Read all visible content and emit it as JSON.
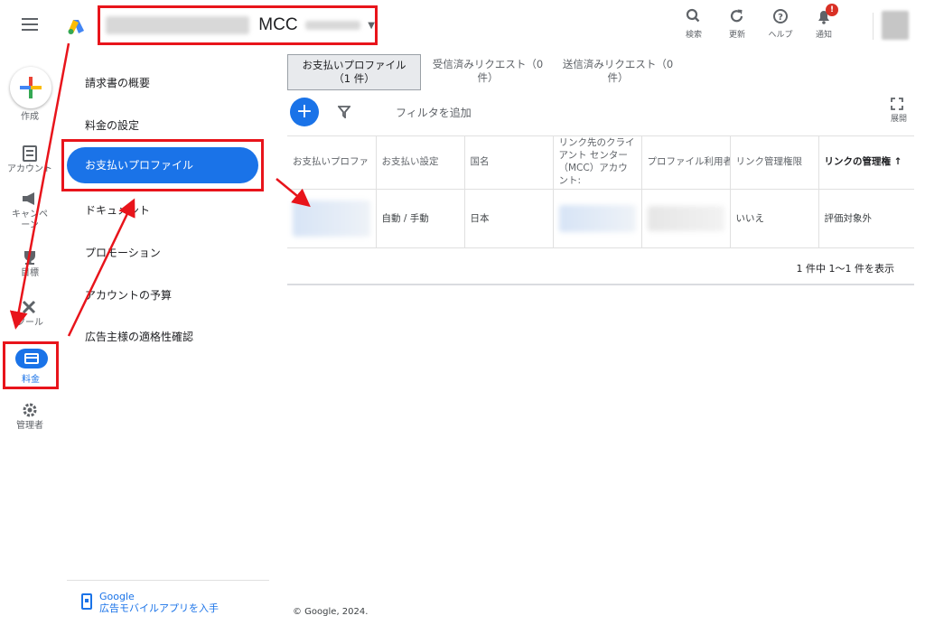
{
  "header": {
    "account_name": "MCC",
    "actions": [
      {
        "label": "検索",
        "icon": "search-icon"
      },
      {
        "label": "更新",
        "icon": "refresh-icon"
      },
      {
        "label": "ヘルプ",
        "icon": "help-icon"
      },
      {
        "label": "通知",
        "icon": "bell-icon",
        "badge": "!"
      }
    ]
  },
  "rail": {
    "create_label": "作成",
    "items": [
      {
        "label": "アカウント",
        "icon": "account-icon"
      },
      {
        "label": "キャンペーン",
        "icon": "megaphone-icon"
      },
      {
        "label": "目標",
        "icon": "trophy-icon"
      },
      {
        "label": "ツール",
        "icon": "tools-icon"
      },
      {
        "label": "料金",
        "icon": "billing-card-icon",
        "active": true
      },
      {
        "label": "管理者",
        "icon": "gear-icon"
      }
    ]
  },
  "subnav": {
    "items": [
      "請求書の概要",
      "料金の設定",
      "お支払いプロファイル",
      "ドキュメント",
      "プロモーション",
      "アカウントの予算",
      "広告主様の適格性確認"
    ],
    "active": "お支払いプロファイル",
    "app_promo_line1": "Google",
    "app_promo_line2": "広告モバイルアプリを入手"
  },
  "tabs": [
    {
      "label": "お支払いプロファイル",
      "count": "（1 件）",
      "active": true
    },
    {
      "label": "受信済みリクエスト（0",
      "count": "件）"
    },
    {
      "label": "送信済みリクエスト（0",
      "count": "件）"
    }
  ],
  "toolbar": {
    "filter_text": "フィルタを追加",
    "expand_label": "展開"
  },
  "table": {
    "columns": [
      "お支払いプロファ",
      "お支払い設定",
      "国名",
      "リンク先のクライアント センター（MCC）アカウント:",
      "プロファイル利用者",
      "リンク管理権限",
      "リンクの管理権"
    ],
    "rows": [
      {
        "payment": "自動 / 手動",
        "country": "日本",
        "link_permission": "いいえ",
        "link_admin": "評価対象外"
      }
    ]
  },
  "pager_text": "1 件中 1〜1 件を表示",
  "footer_text": "© Google, 2024.",
  "colors": {
    "accent": "#1a73e8",
    "annotation": "#e8141b"
  }
}
